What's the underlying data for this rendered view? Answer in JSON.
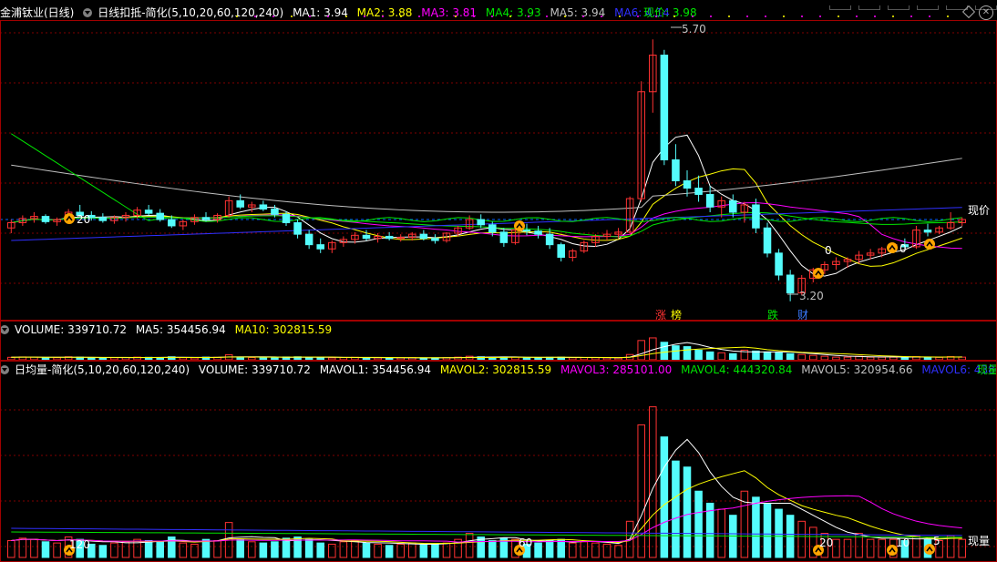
{
  "colors": {
    "up": "#ff3232",
    "down": "#54fcfc",
    "ma1": "#ffffff",
    "ma2": "#ffff00",
    "ma3": "#ff00ff",
    "ma4": "#00e600",
    "ma5": "#c0c0c0",
    "ma6": "#3030ff",
    "border": "#a00000",
    "grid": "#800000",
    "price_line": "#0066ff"
  },
  "header": {
    "stock_name": "金浦钛业(日线)",
    "indicator": "日线扣抵-简化(5,10,20,60,120,240)",
    "ma1": "MA1: 3.94",
    "ma2": "MA2: 3.88",
    "ma3": "MA3: 3.81",
    "ma4": "MA4: 3.93",
    "ma5": "MA5: 3.94",
    "ma6": "MA6: 4.14",
    "current_price": "现价: 3.98"
  },
  "price_panel": {
    "high_label": "5.70",
    "low_label": "3.20",
    "current_tag": "现价",
    "markers": [
      "20",
      "0",
      "0",
      "0",
      "0"
    ],
    "tags": [
      "涨",
      "榜",
      "跌",
      "财"
    ]
  },
  "volume_header": {
    "title": "VOLUME: 339710.72",
    "ma5": "MA5: 354456.94",
    "ma10": "MA10: 302815.59"
  },
  "daily_header": {
    "indicator": "日均量-简化(5,10,20,60,120,240)",
    "volume": "VOLUME: 339710.72",
    "mavol1": "MAVOL1: 354456.94",
    "mavol2": "MAVOL2: 302815.59",
    "mavol3": "MAVOL3: 285101.00",
    "mavol4": "MAVOL4: 444320.84",
    "mavol5": "MAVOL5: 320954.66",
    "mavol6": "MAVOL6: 438642.88",
    "right_tag": "现量"
  },
  "daily_panel": {
    "markers": [
      "120",
      "60",
      "20",
      "10",
      "5"
    ],
    "current_tag": "现量"
  },
  "chart_data": {
    "type": "candlestick",
    "title": "金浦钛业(日线)",
    "price_high": 5.7,
    "price_low": 3.2,
    "price_current": 3.98,
    "ohlc": [
      [
        3.9,
        3.98,
        3.85,
        3.95
      ],
      [
        3.95,
        4.02,
        3.92,
        3.99
      ],
      [
        3.99,
        4.05,
        3.95,
        4.01
      ],
      [
        4.01,
        4.03,
        3.94,
        3.96
      ],
      [
        3.96,
        4.0,
        3.92,
        3.98
      ],
      [
        3.98,
        4.08,
        3.95,
        4.05
      ],
      [
        4.05,
        4.12,
        4.0,
        4.02
      ],
      [
        4.02,
        4.06,
        3.97,
        4.0
      ],
      [
        4.0,
        4.04,
        3.95,
        3.97
      ],
      [
        3.97,
        4.02,
        3.94,
        4.0
      ],
      [
        4.0,
        4.05,
        3.96,
        4.02
      ],
      [
        4.02,
        4.1,
        3.99,
        4.07
      ],
      [
        4.07,
        4.12,
        4.02,
        4.04
      ],
      [
        4.04,
        4.08,
        3.96,
        3.98
      ],
      [
        3.98,
        4.02,
        3.9,
        3.92
      ],
      [
        3.92,
        3.98,
        3.88,
        3.96
      ],
      [
        3.96,
        4.03,
        3.93,
        4.0
      ],
      [
        4.0,
        4.05,
        3.96,
        3.98
      ],
      [
        3.98,
        4.04,
        3.95,
        4.02
      ],
      [
        4.02,
        4.2,
        4.0,
        4.16
      ],
      [
        4.16,
        4.22,
        4.08,
        4.1
      ],
      [
        4.1,
        4.15,
        4.05,
        4.12
      ],
      [
        4.12,
        4.16,
        4.06,
        4.08
      ],
      [
        4.08,
        4.12,
        4.0,
        4.03
      ],
      [
        4.03,
        4.06,
        3.92,
        3.95
      ],
      [
        3.95,
        3.98,
        3.8,
        3.84
      ],
      [
        3.84,
        3.88,
        3.7,
        3.74
      ],
      [
        3.74,
        3.8,
        3.66,
        3.7
      ],
      [
        3.7,
        3.78,
        3.66,
        3.76
      ],
      [
        3.76,
        3.82,
        3.72,
        3.79
      ],
      [
        3.79,
        3.86,
        3.75,
        3.83
      ],
      [
        3.83,
        3.88,
        3.78,
        3.8
      ],
      [
        3.8,
        3.85,
        3.76,
        3.82
      ],
      [
        3.82,
        3.86,
        3.78,
        3.8
      ],
      [
        3.8,
        3.84,
        3.77,
        3.81
      ],
      [
        3.81,
        3.86,
        3.78,
        3.84
      ],
      [
        3.84,
        3.88,
        3.78,
        3.8
      ],
      [
        3.8,
        3.84,
        3.75,
        3.78
      ],
      [
        3.78,
        3.86,
        3.76,
        3.85
      ],
      [
        3.85,
        3.92,
        3.82,
        3.9
      ],
      [
        3.9,
        4.02,
        3.88,
        3.98
      ],
      [
        3.98,
        4.03,
        3.9,
        3.93
      ],
      [
        3.93,
        3.96,
        3.82,
        3.86
      ],
      [
        3.86,
        3.9,
        3.72,
        3.76
      ],
      [
        3.76,
        3.9,
        3.74,
        3.88
      ],
      [
        3.88,
        3.94,
        3.83,
        3.87
      ],
      [
        3.87,
        3.92,
        3.8,
        3.84
      ],
      [
        3.84,
        3.9,
        3.7,
        3.74
      ],
      [
        3.74,
        3.76,
        3.58,
        3.62
      ],
      [
        3.62,
        3.7,
        3.58,
        3.68
      ],
      [
        3.68,
        3.78,
        3.66,
        3.76
      ],
      [
        3.76,
        3.84,
        3.72,
        3.82
      ],
      [
        3.82,
        3.88,
        3.78,
        3.84
      ],
      [
        3.84,
        3.9,
        3.8,
        3.86
      ],
      [
        3.86,
        4.2,
        3.85,
        4.18
      ],
      [
        4.18,
        5.3,
        4.15,
        5.2
      ],
      [
        5.2,
        5.7,
        5.0,
        5.55
      ],
      [
        5.55,
        5.6,
        4.5,
        4.55
      ],
      [
        4.55,
        4.7,
        4.3,
        4.35
      ],
      [
        4.35,
        4.45,
        4.2,
        4.28
      ],
      [
        4.28,
        4.4,
        4.15,
        4.22
      ],
      [
        4.22,
        4.3,
        4.05,
        4.1
      ],
      [
        4.1,
        4.2,
        4.0,
        4.16
      ],
      [
        4.16,
        4.22,
        4.0,
        4.05
      ],
      [
        4.05,
        4.15,
        3.95,
        4.12
      ],
      [
        4.12,
        4.18,
        3.85,
        3.9
      ],
      [
        3.9,
        3.95,
        3.62,
        3.66
      ],
      [
        3.66,
        3.7,
        3.4,
        3.45
      ],
      [
        3.45,
        3.5,
        3.2,
        3.28
      ],
      [
        3.28,
        3.45,
        3.26,
        3.42
      ],
      [
        3.42,
        3.52,
        3.38,
        3.5
      ],
      [
        3.5,
        3.58,
        3.46,
        3.55
      ],
      [
        3.55,
        3.62,
        3.5,
        3.58
      ],
      [
        3.58,
        3.62,
        3.52,
        3.6
      ],
      [
        3.6,
        3.68,
        3.56,
        3.64
      ],
      [
        3.64,
        3.7,
        3.6,
        3.66
      ],
      [
        3.66,
        3.72,
        3.62,
        3.7
      ],
      [
        3.7,
        3.76,
        3.66,
        3.74
      ],
      [
        3.74,
        3.8,
        3.7,
        3.72
      ],
      [
        3.72,
        3.92,
        3.7,
        3.88
      ],
      [
        3.88,
        3.94,
        3.82,
        3.86
      ],
      [
        3.86,
        3.92,
        3.84,
        3.9
      ],
      [
        3.9,
        4.05,
        3.88,
        3.95
      ],
      [
        3.95,
        4.0,
        3.92,
        3.98
      ]
    ],
    "volume": [
      28,
      32,
      30,
      26,
      24,
      34,
      30,
      22,
      20,
      24,
      26,
      30,
      28,
      26,
      34,
      24,
      22,
      30,
      28,
      58,
      30,
      26,
      24,
      26,
      32,
      34,
      30,
      24,
      22,
      26,
      28,
      24,
      22,
      20,
      22,
      24,
      22,
      22,
      24,
      30,
      40,
      34,
      28,
      32,
      30,
      22,
      24,
      28,
      30,
      24,
      26,
      24,
      22,
      20,
      60,
      220,
      250,
      200,
      160,
      150,
      110,
      90,
      80,
      70,
      110,
      100,
      90,
      80,
      70,
      60,
      50,
      40,
      30,
      30,
      40,
      30,
      30,
      30,
      28,
      36,
      30,
      28,
      36,
      30
    ]
  }
}
